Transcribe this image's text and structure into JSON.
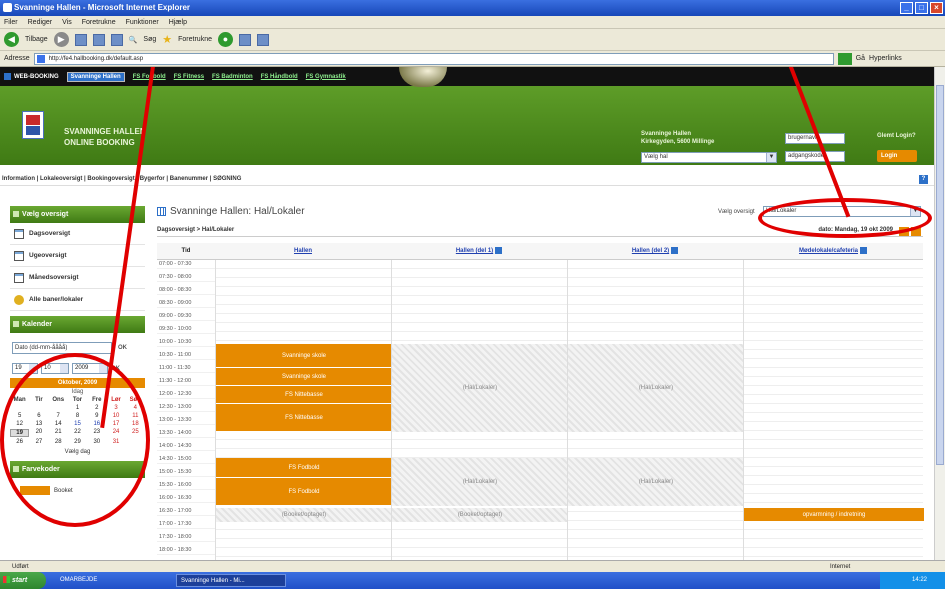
{
  "window": {
    "title": "Svanninge Hallen - Microsoft Internet Explorer",
    "menu": [
      "Filer",
      "Rediger",
      "Vis",
      "Foretrukne",
      "Funktioner",
      "Hjælp"
    ],
    "toolbar": {
      "back": "Tilbage",
      "search": "Søg",
      "favorites": "Foretrukne"
    },
    "address_label": "Adresse",
    "address": "http://fe4.hallbooking.dk/default.asp",
    "go": "Gå",
    "links": "Hyperlinks"
  },
  "topnav": {
    "brand": "WEB-BOOKING",
    "items": [
      "Svanninge Hallen",
      "FS Fodbold",
      "FS Fitness",
      "FS Badminton",
      "FS Håndbold",
      "FS Gymnastik"
    ]
  },
  "header": {
    "title_line1": "SVANNINGE HALLEN",
    "title_line2": "ONLINE BOOKING",
    "contact_line1": "Svanninge Hallen",
    "contact_line2": "Kirkegyden, 5600 Millinge",
    "hall_select": "Vælg hal",
    "username": "brugernavn",
    "password": "adgangskode",
    "forgot": "Glemt Login?",
    "login": "Login"
  },
  "infobar": "Information | Lokaleoversigt | Bookingoversigt | Bygerfor | Banenummer | SØGNING",
  "sidebar": {
    "view_header": "Vælg oversigt",
    "items": [
      "Dagsoversigt",
      "Ugeoversigt",
      "Månedsoversigt",
      "Alle baner/lokaler"
    ],
    "calendar_header": "Kalender",
    "date_placeholder": "Dato (dd-mm-åååå)",
    "ok": "OK",
    "day_sel": "19",
    "month_sel": "10",
    "year_sel": "2009",
    "month_title": "Oktober, 2009",
    "month_sub": "Idag",
    "dow": [
      "Man",
      "Tir",
      "Ons",
      "Tor",
      "Fre",
      "Lør",
      "Søn"
    ],
    "weeks": [
      [
        "",
        "",
        "",
        "1",
        "2",
        "3",
        "4"
      ],
      [
        "5",
        "6",
        "7",
        "8",
        "9",
        "10",
        "11"
      ],
      [
        "12",
        "13",
        "14",
        "15",
        "16",
        "17",
        "18"
      ],
      [
        "19",
        "20",
        "21",
        "22",
        "23",
        "24",
        "25"
      ],
      [
        "26",
        "27",
        "28",
        "29",
        "30",
        "31",
        ""
      ]
    ],
    "today_link": "Vælg dag",
    "legend_header": "Farvekoder",
    "legend_item": "Booket"
  },
  "main": {
    "title": "Svanninge Hallen: Hal/Lokaler",
    "view_label": "Vælg oversigt",
    "view_value": "Hal/Lokaler",
    "breadcrumb": "Dagsoversigt > Hal/Lokaler",
    "date": "dato: Mandag, 19 okt 2009",
    "time_header": "Tid",
    "columns": [
      "Hallen",
      "Hallen (del 1)",
      "Hallen (del 2)",
      "Mødelokale/cafeteria"
    ],
    "times": [
      "07:00 - 07:30",
      "07:30 - 08:00",
      "08:00 - 08:30",
      "08:30 - 09:00",
      "09:00 - 09:30",
      "09:30 - 10:00",
      "10:00 - 10:30",
      "10:30 - 11:00",
      "11:00 - 11:30",
      "11:30 - 12:00",
      "12:00 - 12:30",
      "12:30 - 13:00",
      "13:00 - 13:30",
      "13:30 - 14:00",
      "14:00 - 14:30",
      "14:30 - 15:00",
      "15:00 - 15:30",
      "15:30 - 16:00",
      "16:00 - 16:30",
      "16:30 - 17:00",
      "17:00 - 17:30",
      "17:30 - 18:00",
      "18:00 - 18:30"
    ],
    "bookings": {
      "b1": "Svanninge skole",
      "b2": "Svanninge skole",
      "b3": "FS Nittebasse",
      "b4": "FS Nittebasse",
      "b5": "FS Fodbold",
      "b6": "FS Fodbold",
      "b7": "opvarmning / indretning"
    },
    "occupied": {
      "o1": "(Hal/Lokaler)",
      "o2": "(Hal/Lokaler)",
      "o3": "(Hal/Lokaler)",
      "o4": "(Hal/Lokaler)",
      "o5": "(Booket/optaget)",
      "o6": "(Booket/optaget)"
    }
  },
  "statusbar": {
    "left": "Udført",
    "zone": "Internet"
  },
  "taskbar": {
    "start": "start",
    "tasks": [
      "OMARBEJDE",
      "Svanninge Hallen - Mi..."
    ],
    "clock": "14:22"
  },
  "colors": {
    "green": "#4f8c1e",
    "orange": "#e68a00",
    "annotation": "#e00000"
  }
}
